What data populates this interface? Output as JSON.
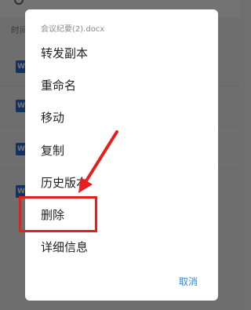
{
  "background": {
    "section_label": "时间",
    "file_icon_letter": "W"
  },
  "dialog": {
    "title": "会议纪要(2).docx",
    "items": [
      {
        "label": "转发副本"
      },
      {
        "label": "重命名"
      },
      {
        "label": "移动"
      },
      {
        "label": "复制"
      },
      {
        "label": "历史版本"
      },
      {
        "label": "删除"
      },
      {
        "label": "详细信息"
      }
    ],
    "cancel_label": "取消"
  },
  "colors": {
    "accent": "#2b86e0",
    "annotation_red": "#e81e1e",
    "file_icon_blue": "#2b6fd1"
  }
}
